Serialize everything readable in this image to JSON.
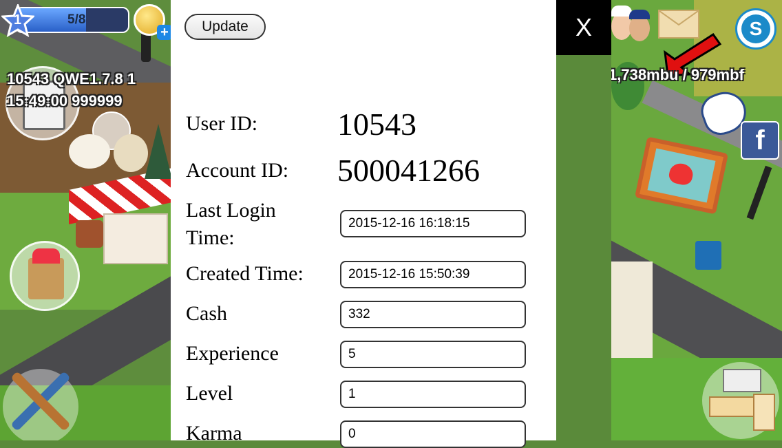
{
  "hud": {
    "level": "1",
    "energy": "5/8",
    "debug_line1": "10543 QWE1.7.8 1",
    "debug_line2": "15:49:00 999999",
    "resources_text": "1,738mbu / 979mbf"
  },
  "panel": {
    "update_label": "Update",
    "close_label": "X",
    "user_id_label": "User ID:",
    "user_id_value": "10543",
    "account_id_label": "Account ID:",
    "account_id_value": "500041266",
    "last_login_label_1": "Last Login",
    "last_login_label_2": "Time:",
    "last_login_value": "2015-12-16 16:18:15",
    "created_label": "Created Time:",
    "created_value": "2015-12-16 15:50:39",
    "cash_label": "Cash",
    "cash_value": "332",
    "experience_label": "Experience",
    "experience_value": "5",
    "level_label": "Level",
    "level_value": "1",
    "karma_label": "Karma",
    "karma_value": "0"
  },
  "colors": {
    "panel_bg": "#ffffff",
    "close_bg": "#000000",
    "energy_bar": "#3b78d8",
    "facebook": "#3b5998",
    "arrow": "#e01010"
  },
  "icons": [
    "star-level-icon",
    "coin-icon",
    "plus-icon",
    "quest-clipboard-icon",
    "grocery-bag-icon",
    "spatula-spoon-icon",
    "mail-icon",
    "social-s-icon",
    "red-arrow-icon",
    "wave-hand-icon",
    "facebook-icon",
    "furniture-icon"
  ]
}
